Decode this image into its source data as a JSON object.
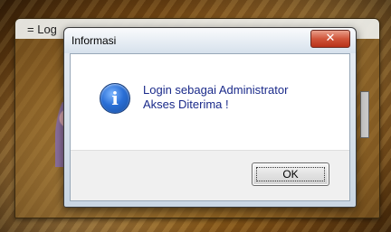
{
  "background_window": {
    "title_prefix": "=",
    "title": "Log"
  },
  "dialog": {
    "title": "Informasi",
    "close_glyph": "✕",
    "icon": "info-icon",
    "icon_glyph": "i",
    "message_lines": [
      "Login sebagai Administrator",
      "Akses Diterima !"
    ],
    "ok_label": "OK"
  },
  "colors": {
    "message_text": "#1a2a8a",
    "close_button": "#c8442a",
    "dialog_frame": "#c9d6e3"
  }
}
